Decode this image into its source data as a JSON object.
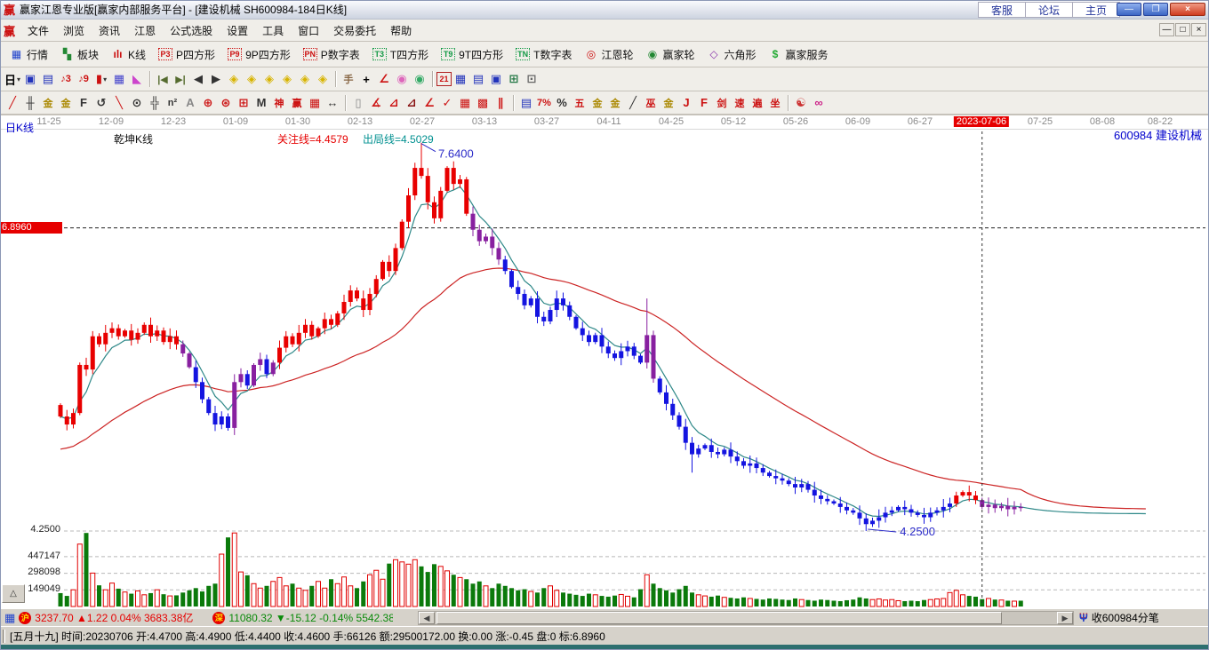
{
  "window": {
    "logo_char": "赢",
    "title": "赢家江恩专业版[赢家内部服务平台] - [建设机械  SH600984-184日K线]",
    "quick_links": [
      "客服",
      "论坛",
      "主页"
    ],
    "controls": {
      "minimize": "—",
      "restore": "❐",
      "close": "×"
    }
  },
  "menu": {
    "logo_char": "赢",
    "items": [
      "文件",
      "浏览",
      "资讯",
      "江恩",
      "公式选股",
      "设置",
      "工具",
      "窗口",
      "交易委托",
      "帮助"
    ],
    "child_controls": [
      "—",
      "□",
      "×"
    ]
  },
  "toolbar_main": [
    {
      "name": "quotes-button",
      "icon": "▦",
      "color": "#2244cc",
      "label": "行情"
    },
    {
      "name": "sectors-button",
      "icon": "▚",
      "color": "#228833",
      "label": "板块"
    },
    {
      "name": "kline-button",
      "icon": "ılı",
      "color": "#cc1111",
      "label": "K线"
    },
    {
      "name": "p-square-button",
      "icon": "P3",
      "color": "#cc1111",
      "boxed": true,
      "label": "P四方形"
    },
    {
      "name": "p9-square-button",
      "icon": "P9",
      "color": "#cc1111",
      "boxed": true,
      "label": "9P四方形"
    },
    {
      "name": "p-number-button",
      "icon": "PN",
      "color": "#cc1111",
      "boxed": true,
      "label": "P数字表"
    },
    {
      "name": "t-square-button",
      "icon": "T3",
      "color": "#119944",
      "boxed": true,
      "label": "T四方形"
    },
    {
      "name": "t9-square-button",
      "icon": "T9",
      "color": "#119944",
      "boxed": true,
      "label": "9T四方形"
    },
    {
      "name": "t-number-button",
      "icon": "TN",
      "color": "#119944",
      "boxed": true,
      "label": "T数字表"
    },
    {
      "name": "gann-wheel-button",
      "icon": "◎",
      "color": "#cc1111",
      "label": "江恩轮"
    },
    {
      "name": "winner-wheel-button",
      "icon": "◉",
      "color": "#228833",
      "label": "赢家轮"
    },
    {
      "name": "hexagon-button",
      "icon": "◇",
      "color": "#8833aa",
      "label": "六角形"
    },
    {
      "name": "winner-service-button",
      "icon": "$",
      "color": "#22aa33",
      "label": "赢家服务"
    }
  ],
  "toolbar_nav": [
    {
      "name": "period-day-dropdown",
      "g": "日",
      "c": "#000000",
      "caret": true
    },
    {
      "name": "zen-window-icon",
      "g": "▣",
      "c": "#2233bb"
    },
    {
      "name": "self-select-icon",
      "g": "▤",
      "c": "#2233bb"
    },
    {
      "name": "mini-chart3-icon",
      "g": "♪3",
      "c": "#cc1111",
      "small": true
    },
    {
      "name": "mini-chart9-icon",
      "g": "♪9",
      "c": "#cc1111",
      "small": true
    },
    {
      "name": "candle-style-dropdown",
      "g": "▮",
      "c": "#cc1111",
      "caret": true
    },
    {
      "name": "qiankun-pattern-icon",
      "g": "▦",
      "c": "#4444cc"
    },
    {
      "name": "color-flag-icon",
      "g": "◣",
      "c": "#cc44cc"
    },
    {
      "name": "sep1",
      "sep": true
    },
    {
      "name": "first-page-icon",
      "g": "|◀",
      "c": "#556b2f",
      "small": true
    },
    {
      "name": "last-page-icon",
      "g": "▶|",
      "c": "#556b2f",
      "small": true
    },
    {
      "name": "prev-candle-icon",
      "g": "◀",
      "c": "#333333"
    },
    {
      "name": "next-candle-icon",
      "g": "▶",
      "c": "#333333"
    },
    {
      "name": "diamond-left-icon",
      "g": "◈",
      "c": "#d8b400"
    },
    {
      "name": "diamond-right-icon",
      "g": "◈",
      "c": "#d8b400"
    },
    {
      "name": "diamond-hcompress-icon",
      "g": "◈",
      "c": "#d8b400"
    },
    {
      "name": "diamond-hexpand-icon",
      "g": "◈",
      "c": "#d8b400"
    },
    {
      "name": "diamond-expand-icon",
      "g": "◈",
      "c": "#d8b400"
    },
    {
      "name": "diamond-compress-icon",
      "g": "◈",
      "c": "#d8b400"
    },
    {
      "name": "sep2",
      "sep": true
    },
    {
      "name": "hand-drag-icon",
      "g": "手",
      "c": "#886644",
      "small": true
    },
    {
      "name": "crosshair-icon",
      "g": "+",
      "c": "#000000"
    },
    {
      "name": "angle-measure-icon",
      "g": "∠",
      "c": "#cc1111"
    },
    {
      "name": "gann-brain-pink-icon",
      "g": "◉",
      "c": "#dd66bb"
    },
    {
      "name": "gann-brain-green-icon",
      "g": "◉",
      "c": "#33aa66"
    },
    {
      "name": "sep3",
      "sep": true
    },
    {
      "name": "calendar-icon",
      "g": "21",
      "c": "#cc1111",
      "boxy": true
    },
    {
      "name": "calculator-icon",
      "g": "▦",
      "c": "#2233bb"
    },
    {
      "name": "notebook-icon",
      "g": "▤",
      "c": "#2233bb"
    },
    {
      "name": "save-icon",
      "g": "▣",
      "c": "#2233bb"
    },
    {
      "name": "data-export-icon",
      "g": "⊞",
      "c": "#227744"
    },
    {
      "name": "install-tools-icon",
      "g": "⊡",
      "c": "#666666"
    }
  ],
  "toolbar_draw": [
    {
      "name": "draw-line-icon",
      "g": "╱",
      "c": "#cc1111"
    },
    {
      "name": "grid-tool-icon",
      "g": "╫",
      "c": "#333333"
    },
    {
      "name": "golden-section-icon",
      "g": "金",
      "c": "#aa8800",
      "small": true
    },
    {
      "name": "golden-grid-icon",
      "g": "金",
      "c": "#aa8800",
      "small": true
    },
    {
      "name": "fib-levels-icon",
      "g": "F",
      "c": "#333333"
    },
    {
      "name": "spiral-icon",
      "g": "↺",
      "c": "#333333"
    },
    {
      "name": "brush-icon",
      "g": "╲",
      "c": "#cc1111"
    },
    {
      "name": "cycle-clock-icon",
      "g": "⊙",
      "c": "#333333"
    },
    {
      "name": "dense-grid-icon",
      "g": "╬",
      "c": "#333333"
    },
    {
      "name": "n-square-icon",
      "g": "n²",
      "c": "#333333",
      "small": true
    },
    {
      "name": "angle-ruler-icon",
      "g": "A",
      "c": "#888888"
    },
    {
      "name": "gann-compass-icon",
      "g": "⊕",
      "c": "#cc1111"
    },
    {
      "name": "star-rays-icon",
      "g": "⊛",
      "c": "#cc1111"
    },
    {
      "name": "square-target-icon",
      "g": "⊞",
      "c": "#cc1111"
    },
    {
      "name": "wave-mark-icon",
      "g": "M",
      "c": "#333333"
    },
    {
      "name": "shen-tool-icon",
      "g": "神",
      "c": "#cc1111",
      "small": true
    },
    {
      "name": "ying-tool-icon",
      "g": "赢",
      "c": "#cc1111",
      "small": true
    },
    {
      "name": "number-grid-icon",
      "g": "▦",
      "c": "#cc1111"
    },
    {
      "name": "hspan-icon",
      "g": "↔",
      "c": "#333333"
    },
    {
      "name": "sepA",
      "sep": true
    },
    {
      "name": "door-panel-icon",
      "g": "▯",
      "c": "#888888"
    },
    {
      "name": "speed-fan-icon",
      "g": "∡",
      "c": "#cc1111"
    },
    {
      "name": "box-fan-icon",
      "g": "⊿",
      "c": "#cc1111"
    },
    {
      "name": "shaded-fan-icon",
      "g": "⊿",
      "c": "#881111"
    },
    {
      "name": "trend-fan-icon",
      "g": "∠",
      "c": "#cc1111"
    },
    {
      "name": "check-line-icon",
      "g": "✓",
      "c": "#cc1111"
    },
    {
      "name": "red-grid-icon",
      "g": "▦",
      "c": "#cc1111"
    },
    {
      "name": "red-shade-grid-icon",
      "g": "▩",
      "c": "#cc1111"
    },
    {
      "name": "slant-lines-icon",
      "g": "∥",
      "c": "#cc1111"
    },
    {
      "name": "sepB",
      "sep": true
    },
    {
      "name": "price-ladder-icon",
      "g": "▤",
      "c": "#2233bb"
    },
    {
      "name": "seven-pct-icon",
      "g": "7%",
      "c": "#cc1111",
      "small": true
    },
    {
      "name": "percent-icon",
      "g": "%",
      "c": "#333333"
    },
    {
      "name": "five-elements-icon",
      "g": "五",
      "c": "#cc1111",
      "small": true
    },
    {
      "name": "gold-circle-icon",
      "g": "金",
      "c": "#aa8800",
      "small": true
    },
    {
      "name": "gold-line-icon",
      "g": "金",
      "c": "#aa8800",
      "small": true
    },
    {
      "name": "pen-measure-icon",
      "g": "╱",
      "c": "#333333"
    },
    {
      "name": "wu-tool-icon",
      "g": "巫",
      "c": "#cc1111",
      "small": true
    },
    {
      "name": "gold-under-icon",
      "g": "金",
      "c": "#aa8800",
      "small": true
    },
    {
      "name": "j-angle-icon",
      "g": "J",
      "c": "#cc1111"
    },
    {
      "name": "f-angle-icon",
      "g": "F",
      "c": "#cc1111"
    },
    {
      "name": "sword-angle-icon",
      "g": "剑",
      "c": "#cc1111",
      "small": true
    },
    {
      "name": "speed-angle-icon",
      "g": "速",
      "c": "#cc1111",
      "small": true
    },
    {
      "name": "bian-angle-icon",
      "g": "遍",
      "c": "#cc1111",
      "small": true
    },
    {
      "name": "zuo-angle-icon",
      "g": "坐",
      "c": "#cc1111",
      "small": true
    },
    {
      "name": "sepC",
      "sep": true
    },
    {
      "name": "taichi-icon",
      "g": "☯",
      "c": "#cc3333"
    },
    {
      "name": "infinity-icon",
      "g": "∞",
      "c": "#cc2288"
    }
  ],
  "chart": {
    "pane_label": "日K线",
    "legend_name": "乾坤K线",
    "legend_watch": "关注线=4.4579",
    "legend_exit": "出局线=4.5029",
    "stock_label": "600984 建设机械",
    "level_label": "6.8960",
    "price_bottom": "4.2500",
    "vol_labels": [
      "447147",
      "298098",
      "149049"
    ],
    "peak_label": "7.6400",
    "low_label": "4.2500",
    "corner_button": "△",
    "dates": [
      "11-25",
      "12-09",
      "12-23",
      "01-09",
      "01-30",
      "02-13",
      "02-27",
      "03-13",
      "03-27",
      "04-11",
      "04-25",
      "05-12",
      "05-26",
      "06-09",
      "06-27",
      "2023-07-06",
      "07-25",
      "08-08",
      "08-22"
    ],
    "date_xs": [
      55,
      125,
      195,
      265,
      335,
      405,
      475,
      545,
      615,
      685,
      755,
      825,
      895,
      965,
      1035,
      1104,
      1170,
      1240,
      1305
    ],
    "highlight_date_index": 15
  },
  "chart_data": {
    "type": "candlestick+volume",
    "symbol": "SH600984",
    "title": "建设机械 SH600984 184日K线 乾坤K线",
    "price_axis": {
      "bottom": 4.25,
      "level_line": 6.896,
      "peak_high": 7.64,
      "trough_low": 4.25
    },
    "volume_axis_ticks": [
      149049,
      298098,
      447147
    ],
    "open_first": 5.35,
    "closes": [
      5.25,
      5.18,
      5.28,
      5.7,
      5.66,
      5.95,
      5.88,
      5.98,
      6.02,
      5.95,
      6.0,
      5.92,
      5.98,
      6.05,
      5.95,
      6.0,
      5.9,
      5.95,
      5.88,
      5.8,
      5.68,
      5.55,
      5.4,
      5.28,
      5.18,
      5.25,
      5.15,
      5.55,
      5.62,
      5.52,
      5.7,
      5.75,
      5.62,
      5.72,
      5.85,
      5.95,
      5.88,
      5.98,
      6.05,
      5.95,
      6.02,
      6.1,
      6.05,
      6.15,
      6.25,
      6.35,
      6.28,
      6.18,
      6.32,
      6.45,
      6.6,
      6.52,
      6.72,
      6.95,
      7.18,
      7.42,
      7.35,
      7.12,
      6.98,
      7.22,
      7.42,
      7.28,
      7.32,
      7.02,
      6.88,
      6.78,
      6.82,
      6.72,
      6.62,
      6.52,
      6.38,
      6.32,
      6.22,
      6.28,
      6.12,
      6.08,
      6.18,
      6.28,
      6.22,
      6.12,
      6.02,
      5.96,
      5.9,
      5.96,
      5.86,
      5.8,
      5.76,
      5.82,
      5.86,
      5.78,
      5.72,
      5.96,
      5.58,
      5.46,
      5.36,
      5.26,
      5.16,
      5.02,
      4.92,
      4.97,
      5.0,
      4.94,
      4.92,
      4.96,
      4.9,
      4.86,
      4.82,
      4.84,
      4.8,
      4.76,
      4.73,
      4.71,
      4.69,
      4.66,
      4.63,
      4.66,
      4.61,
      4.56,
      4.53,
      4.51,
      4.49,
      4.46,
      4.43,
      4.41,
      4.36,
      4.31,
      4.34,
      4.37,
      4.41,
      4.43,
      4.46,
      4.44,
      4.41,
      4.39,
      4.37,
      4.41,
      4.43,
      4.46,
      4.49,
      4.56,
      4.59,
      4.56,
      4.52,
      4.46,
      4.48,
      4.45,
      4.47,
      4.44,
      4.46,
      4.45
    ],
    "color_runs": [
      [
        19,
        "r"
      ],
      [
        2,
        "p"
      ],
      [
        6,
        "b"
      ],
      [
        2,
        "p"
      ],
      [
        1,
        "b"
      ],
      [
        2,
        "p"
      ],
      [
        1,
        "b"
      ],
      [
        1,
        "p"
      ],
      [
        30,
        "r"
      ],
      [
        5,
        "p"
      ],
      [
        22,
        "b"
      ],
      [
        2,
        "p"
      ],
      [
        46,
        "b"
      ],
      [
        4,
        "r"
      ],
      [
        7,
        "p"
      ]
    ],
    "volumes_k": [
      120,
      95,
      150,
      560,
      660,
      300,
      190,
      150,
      210,
      160,
      130,
      115,
      140,
      105,
      120,
      150,
      110,
      95,
      100,
      125,
      145,
      165,
      135,
      185,
      205,
      470,
      620,
      660,
      310,
      280,
      205,
      165,
      185,
      225,
      260,
      185,
      205,
      165,
      145,
      185,
      225,
      165,
      245,
      205,
      265,
      185,
      165,
      225,
      285,
      325,
      245,
      385,
      420,
      400,
      380,
      420,
      360,
      310,
      380,
      360,
      320,
      285,
      260,
      245,
      205,
      225,
      185,
      165,
      205,
      185,
      165,
      145,
      155,
      135,
      125,
      165,
      185,
      145,
      125,
      115,
      105,
      95,
      115,
      105,
      95,
      88,
      98,
      108,
      92,
      82,
      155,
      285,
      205,
      165,
      145,
      125,
      155,
      185,
      125,
      105,
      95,
      88,
      98,
      82,
      78,
      72,
      82,
      72,
      68,
      62,
      72,
      68,
      62,
      58,
      72,
      62,
      58,
      52,
      62,
      58,
      52,
      48,
      56,
      62,
      82,
      72,
      62,
      68,
      58,
      62,
      52,
      48,
      52,
      48,
      58,
      62,
      68,
      72,
      125,
      145,
      105,
      95,
      88,
      66,
      72,
      62,
      58,
      52,
      48,
      52
    ],
    "wick_overrides": {
      "56": {
        "high": 7.64
      },
      "91": {
        "high": 6.28
      },
      "98": {
        "low": 4.76
      },
      "125": {
        "low": 4.25
      }
    },
    "crosshair_index": 143,
    "annotations": [
      {
        "name": "peak",
        "text": "7.6400",
        "index": 56,
        "price": 7.64
      },
      {
        "name": "trough",
        "text": "4.2500",
        "index": 125,
        "price": 4.25
      }
    ],
    "colors": {
      "up_candle": "#e80000",
      "down_candle": "#1414e0",
      "shift_candle": "#8820a0",
      "ma_fast": "#2e8888",
      "ma_slow": "#cc2424",
      "vol_up_stroke": "#e00000",
      "vol_down_fill": "#0b7a0b",
      "annotation": "#2b2bc8",
      "level_line": "#222222",
      "grid_dash": "#b8b8b8"
    }
  },
  "market_bar": {
    "sh": {
      "icon": "沪",
      "index": "3237.70",
      "change": "▲1.22",
      "pct": "0.04%",
      "amount": "3683.38亿"
    },
    "sz": {
      "icon": "深",
      "index": "11080.32",
      "change": "▼-15.12",
      "pct": "-0.14%",
      "amount": "5542.38"
    },
    "ticker": "收600984分笔"
  },
  "status_bar": {
    "lunar": "[五月十九]",
    "fields": [
      "时间:20230706",
      "开:4.4700",
      "高:4.4900",
      "低:4.4400",
      "收:4.4600",
      "手:66126",
      "额:29500172.00",
      "换:0.00",
      "涨:-0.45",
      "盘:0",
      "标:6.8960"
    ]
  }
}
